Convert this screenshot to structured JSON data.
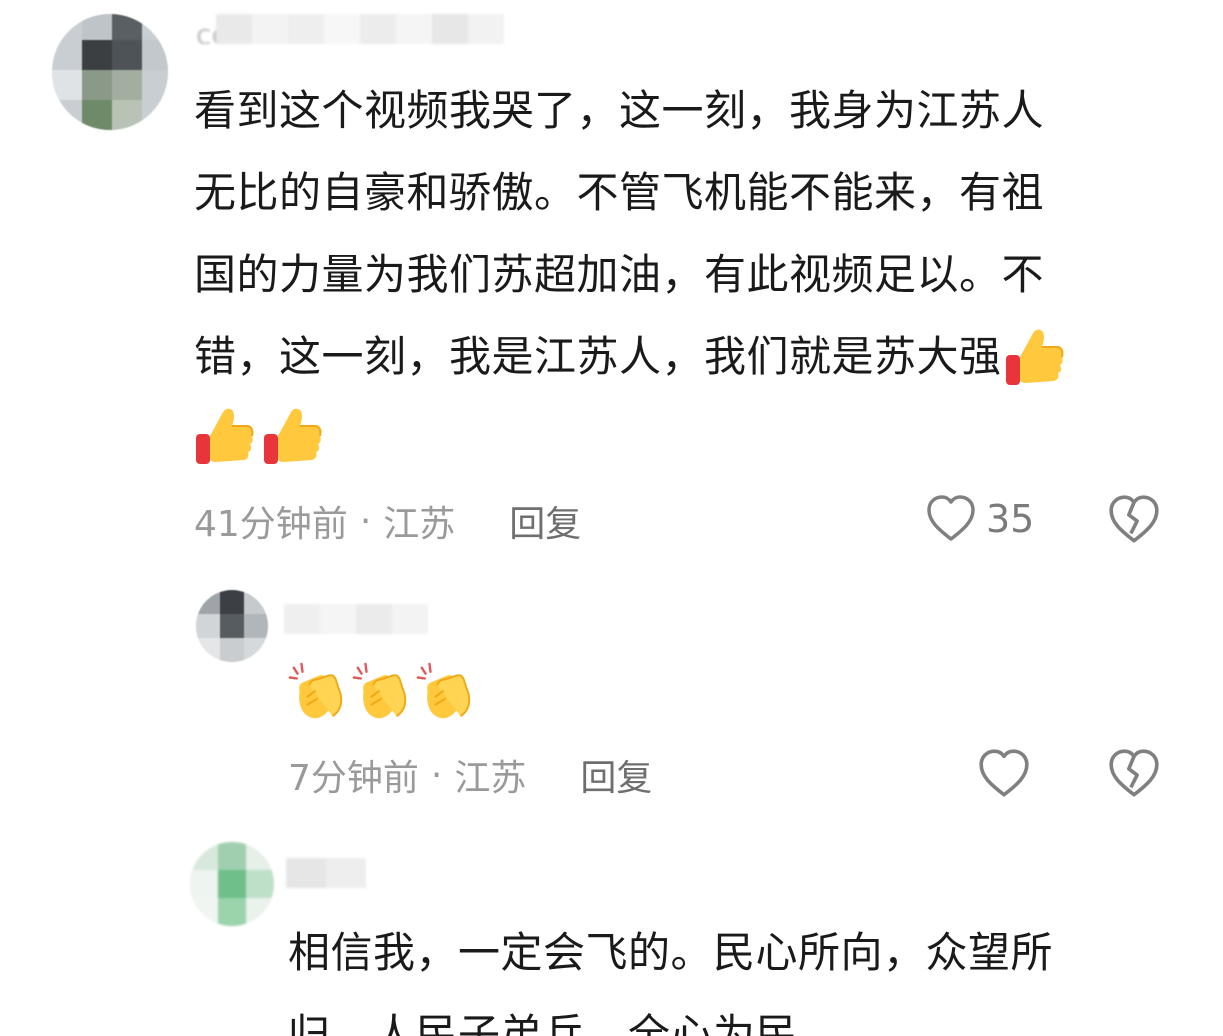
{
  "comments": [
    {
      "name": "cc",
      "lines": [
        "看到这个视频我哭了，这一刻，我身为江苏人",
        "无比的自豪和骄傲。不管飞机能不能来，有祖",
        "国的力量为我们苏超加油，有此视频足以。不",
        "错，这一刻，我是江苏人，我们就是苏大强"
      ],
      "emoji_trailing": "thumbs-up-icon",
      "emoji_line": [
        "thumbs-up-icon",
        "thumbs-up-icon"
      ],
      "time": "41分钟前",
      "dot": "·",
      "location": "江苏",
      "reply_label": "回复",
      "like_count": "35"
    },
    {
      "emoji_line": [
        "clapping-hands-icon",
        "clapping-hands-icon",
        "clapping-hands-icon"
      ],
      "time": "7分钟前",
      "dot": "·",
      "location": "江苏",
      "reply_label": "回复"
    },
    {
      "lines": [
        "相信我，一定会飞的。民心所向，众望所",
        "归，人民子弟兵，全心为民"
      ]
    }
  ],
  "colors": {
    "text": "#1a1a1a",
    "meta": "#9a9a9a",
    "reply": "#6f6f6f",
    "icon_stroke": "#808080",
    "thumb_yellow": "#ffc83d",
    "thumb_red": "#e8343b"
  }
}
